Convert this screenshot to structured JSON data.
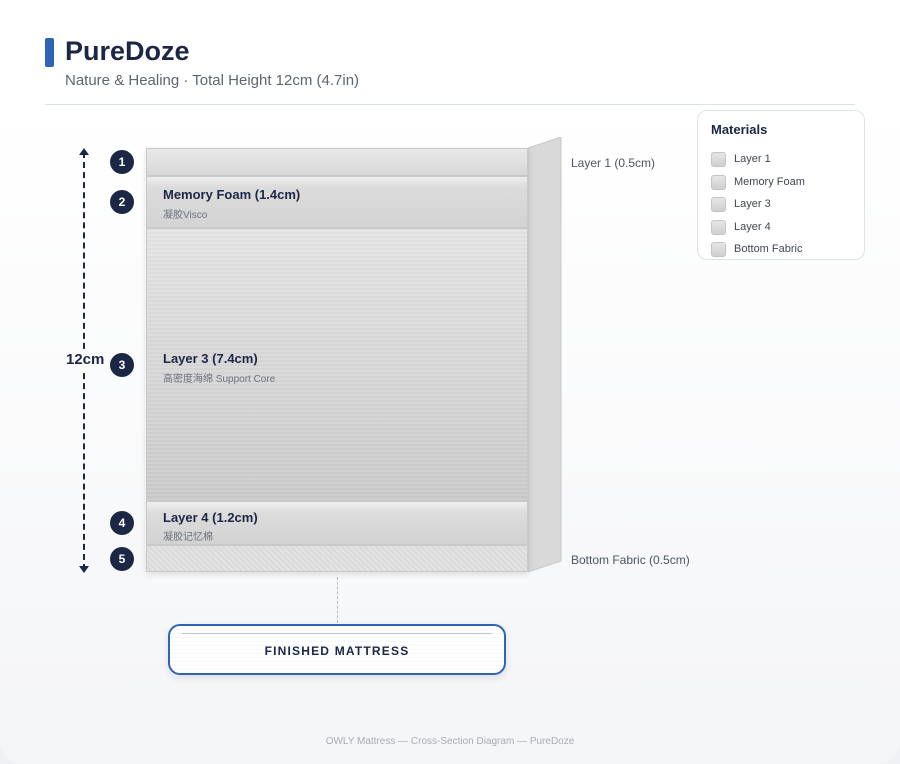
{
  "header": {
    "title": "PureDoze",
    "subtitle": "Nature & Healing · Total Height 12cm (4.7in)"
  },
  "dimension": {
    "label": "12cm"
  },
  "layers": [
    {
      "number": "1",
      "name": "",
      "desc": "",
      "side_label": "Layer 1 (0.5cm)"
    },
    {
      "number": "2",
      "name": "Memory Foam (1.4cm)",
      "desc": "凝胶Visco",
      "side_label": ""
    },
    {
      "number": "3",
      "name": "Layer 3 (7.4cm)",
      "desc": "高密度海绵 Support Core",
      "side_label": ""
    },
    {
      "number": "4",
      "name": "Layer 4 (1.2cm)",
      "desc": "凝胶记忆棉",
      "side_label": ""
    },
    {
      "number": "5",
      "name": "",
      "desc": "",
      "side_label": "Bottom Fabric (0.5cm)"
    }
  ],
  "legend": {
    "title": "Materials",
    "items": [
      "Layer 1",
      "Memory Foam",
      "Layer 3",
      "Layer 4",
      "Bottom Fabric"
    ]
  },
  "finished": {
    "label": "FINISHED MATTRESS"
  },
  "footer": "OWLY Mattress — Cross-Section Diagram — PureDoze",
  "colors": {
    "accent": "#2f63b6",
    "navy": "#1b2744",
    "layer_gray": "#d6d6d6"
  }
}
